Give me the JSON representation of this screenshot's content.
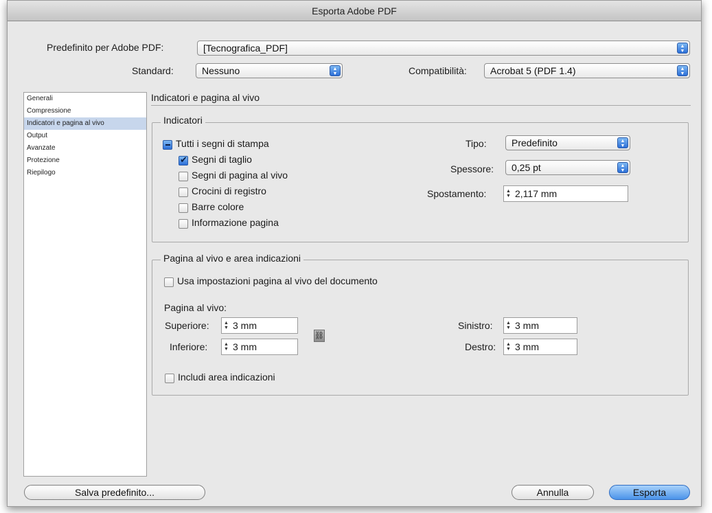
{
  "window": {
    "title": "Esporta Adobe PDF"
  },
  "top": {
    "preset_label": "Predefinito per Adobe PDF:",
    "preset_value": "[Tecnografica_PDF]",
    "standard_label": "Standard:",
    "standard_value": "Nessuno",
    "compat_label": "Compatibilità:",
    "compat_value": "Acrobat 5 (PDF 1.4)"
  },
  "sidebar": {
    "items": [
      "Generali",
      "Compressione",
      "Indicatori e pagina al vivo",
      "Output",
      "Avanzate",
      "Protezione",
      "Riepilogo"
    ],
    "selected_index": 2
  },
  "panel": {
    "title": "Indicatori e pagina al vivo",
    "marks": {
      "group_title": "Indicatori",
      "all_marks": "Tutti i segni di stampa",
      "crop": "Segni di taglio",
      "bleed": "Segni di pagina al vivo",
      "registration": "Crocini di registro",
      "color_bars": "Barre colore",
      "page_info": "Informazione pagina",
      "type_label": "Tipo:",
      "type_value": "Predefinito",
      "weight_label": "Spessore:",
      "weight_value": "0,25 pt",
      "offset_label": "Spostamento:",
      "offset_value": "2,117 mm"
    },
    "bleed": {
      "group_title": "Pagina al vivo e area indicazioni",
      "use_doc": "Usa impostazioni pagina al vivo del documento",
      "bleed_label": "Pagina al vivo:",
      "top_label": "Superiore:",
      "top_value": "3 mm",
      "bottom_label": "Inferiore:",
      "bottom_value": "3 mm",
      "left_label": "Sinistro:",
      "left_value": "3 mm",
      "right_label": "Destro:",
      "right_value": "3 mm",
      "include_slug": "Includi area indicazioni"
    }
  },
  "buttons": {
    "save_preset": "Salva predefinito...",
    "cancel": "Annulla",
    "export": "Esporta"
  }
}
